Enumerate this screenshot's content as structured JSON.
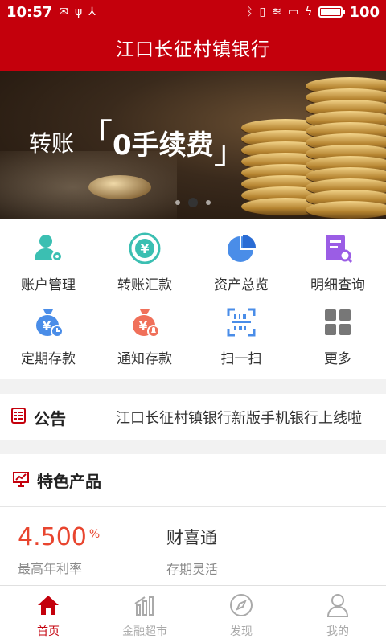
{
  "status_bar": {
    "time": "10:57",
    "battery": "100",
    "battery_level": 1.0
  },
  "header": {
    "title": "江口长征村镇银行"
  },
  "banner": {
    "lead": "转账",
    "highlight": "0手续费",
    "bracket_left": "「",
    "bracket_right": "」",
    "slides": 3,
    "active_slide": 2
  },
  "quick_actions": [
    {
      "label": "账户管理",
      "icon": "account-user-icon"
    },
    {
      "label": "转账汇款",
      "icon": "yuan-circle-icon"
    },
    {
      "label": "资产总览",
      "icon": "pie-chart-icon"
    },
    {
      "label": "明细查询",
      "icon": "document-search-icon"
    },
    {
      "label": "定期存款",
      "icon": "money-bag-clock-icon"
    },
    {
      "label": "通知存款",
      "icon": "money-bag-bell-icon"
    },
    {
      "label": "扫一扫",
      "icon": "scan-icon"
    },
    {
      "label": "更多",
      "icon": "grid-more-icon"
    }
  ],
  "notice": {
    "title": "公告",
    "text": "江口长征村镇银行新版手机银行上线啦"
  },
  "featured": {
    "title": "特色产品",
    "products": [
      {
        "rate": "4.500",
        "unit": "%",
        "desc": "最高年利率"
      },
      {
        "name": "财喜通",
        "desc": "存期灵活"
      }
    ]
  },
  "tabs": [
    {
      "label": "首页",
      "icon": "home-icon",
      "active": true
    },
    {
      "label": "金融超市",
      "icon": "chart-bars-icon",
      "active": false
    },
    {
      "label": "发现",
      "icon": "compass-icon",
      "active": false
    },
    {
      "label": "我的",
      "icon": "user-icon",
      "active": false
    }
  ],
  "colors": {
    "brand": "#c4000c",
    "accent_rate": "#e8452f",
    "tab_inactive": "#aaaaaa"
  }
}
